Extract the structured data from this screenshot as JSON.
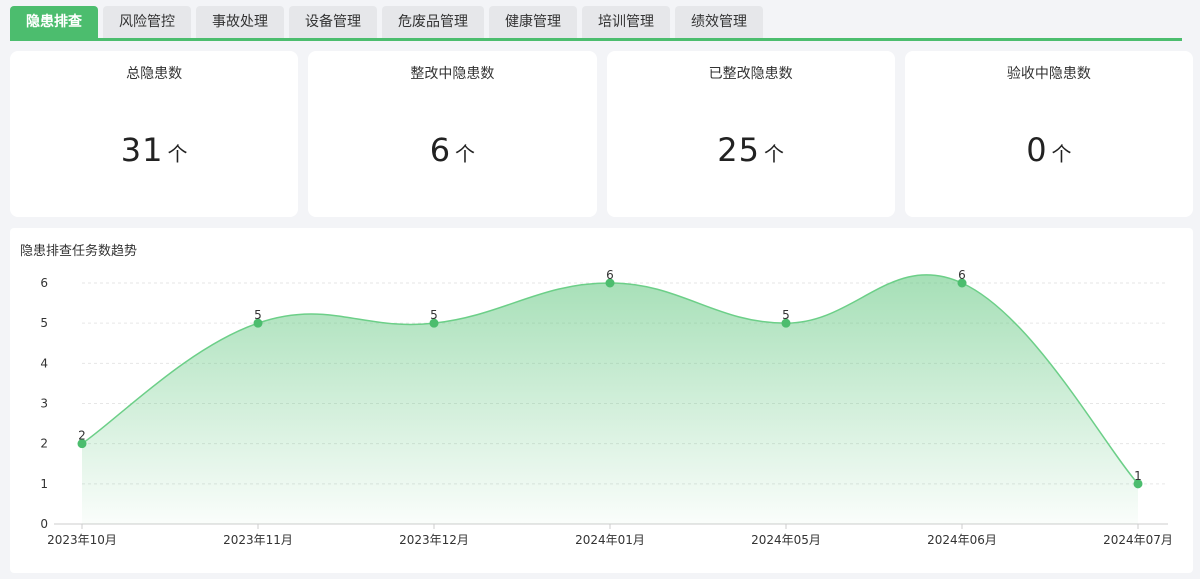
{
  "tabs": [
    {
      "label": "隐患排查",
      "active": true
    },
    {
      "label": "风险管控",
      "active": false
    },
    {
      "label": "事故处理",
      "active": false
    },
    {
      "label": "设备管理",
      "active": false
    },
    {
      "label": "危废品管理",
      "active": false
    },
    {
      "label": "健康管理",
      "active": false
    },
    {
      "label": "培训管理",
      "active": false
    },
    {
      "label": "绩效管理",
      "active": false
    }
  ],
  "cards": [
    {
      "title": "总隐患数",
      "value": "31",
      "unit": "个"
    },
    {
      "title": "整改中隐患数",
      "value": "6",
      "unit": "个"
    },
    {
      "title": "已整改隐患数",
      "value": "25",
      "unit": "个"
    },
    {
      "title": "验收中隐患数",
      "value": "0",
      "unit": "个"
    }
  ],
  "colors": {
    "accent": "#4cbd6e",
    "line": "#6ccf88"
  },
  "chart_data": {
    "type": "area",
    "title": "隐患排查任务数趋势",
    "categories": [
      "2023年10月",
      "2023年11月",
      "2023年12月",
      "2024年01月",
      "2024年05月",
      "2024年06月",
      "2024年07月"
    ],
    "values": [
      2,
      5,
      5,
      6,
      5,
      6,
      1
    ],
    "ylim": [
      0,
      6
    ],
    "yticks": [
      0,
      1,
      2,
      3,
      4,
      5,
      6
    ],
    "grid": true,
    "smooth": true,
    "data_labels": true
  }
}
